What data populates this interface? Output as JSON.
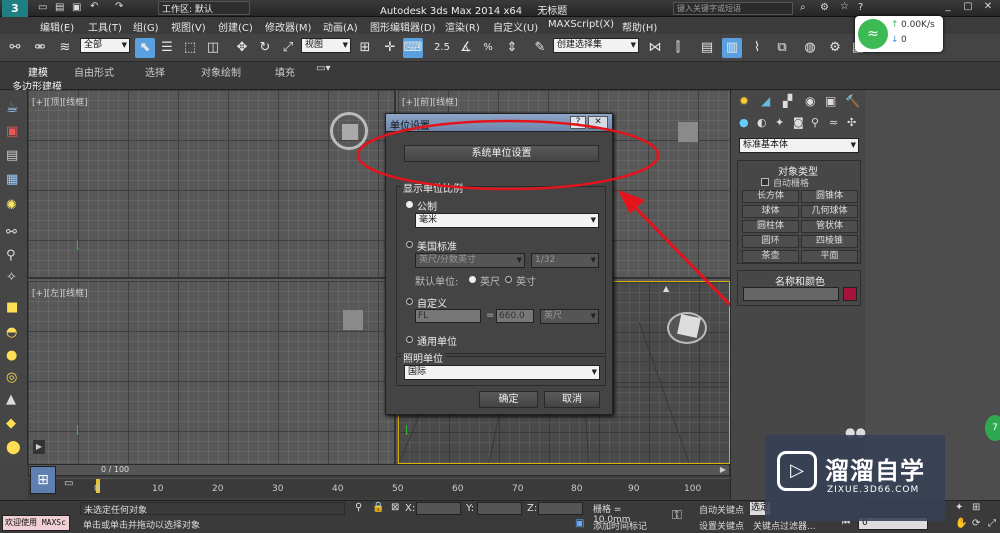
{
  "app": {
    "title": "Autodesk 3ds Max  2014 x64",
    "file": "无标题",
    "workspace": "工作区: 默认",
    "search_placeholder": "键入关键字或短语"
  },
  "menu": [
    "编辑(E)",
    "工具(T)",
    "组(G)",
    "视图(V)",
    "创建(C)",
    "修改器(M)",
    "动画(A)",
    "图形编辑器(D)",
    "渲染(R)",
    "自定义(U)",
    "MAXScript(X)",
    "帮助(H)"
  ],
  "toolbar": {
    "filter": "全部",
    "coord": "视图",
    "selection_set": "创建选择集",
    "snap": "2.5",
    "percent": "%"
  },
  "ribbon": {
    "tabs": [
      "建模",
      "自由形式",
      "选择",
      "对象绘制",
      "填充"
    ],
    "sub_label": "多边形建模"
  },
  "viewports": {
    "top": "[+][顶][线框]",
    "front": "[+][前][线框]",
    "left": "[+][左][线框]"
  },
  "dialog": {
    "title": "单位设置",
    "help": "?",
    "system_units_btn": "系统单位设置",
    "display_group": "显示单位比例",
    "metric_label": "公制",
    "metric_value": "毫米",
    "us_label": "美国标准",
    "us_value": "英尺/分数英寸",
    "us_fraction": "1/32",
    "default_units_label": "默认单位:",
    "feet_label": "英尺",
    "inch_label": "英寸",
    "custom_label": "自定义",
    "custom_name": "FL",
    "custom_equals": "=",
    "custom_value": "660.0",
    "custom_unit": "英尺",
    "generic_label": "通用单位",
    "lighting_group": "照明单位",
    "lighting_value": "国际",
    "ok": "确定",
    "cancel": "取消"
  },
  "cmdpanel": {
    "category": "标准基本体",
    "object_type": "对象类型",
    "autogrid": "自动栅格",
    "buttons": [
      "长方体",
      "圆锥体",
      "球体",
      "几何球体",
      "圆柱体",
      "管状体",
      "圆环",
      "四棱锥",
      "茶壶",
      "平面"
    ],
    "name_color": "名称和颜色"
  },
  "timeline": {
    "frame": "0 / 100",
    "ticks": [
      "0",
      "10",
      "20",
      "30",
      "40",
      "50",
      "60",
      "70",
      "80",
      "90",
      "100"
    ]
  },
  "status": {
    "script_prompt": "欢迎使用 MAXSc",
    "line1": "未选定任何对象",
    "line2": "单击或单击并拖动以选择对象",
    "x_label": "X:",
    "y_label": "Y:",
    "z_label": "Z:",
    "grid": "栅格 = 10.0mm",
    "add_time_tag": "添加时间标记",
    "auto_key": "自动关键点",
    "set_key": "设置关键点",
    "selected_short": "选定",
    "key_filters": "关键点过滤器...",
    "frame_field": "0"
  },
  "network": {
    "up": "0.00K/s",
    "down": "0"
  },
  "watermark": {
    "name": "溜溜自学",
    "url": "ZIXUE.3D66.COM"
  },
  "colors": {
    "annotation_red": "#e3141b",
    "accent_blue": "#2d7fd0",
    "ui_dark": "#3b3b3b"
  }
}
